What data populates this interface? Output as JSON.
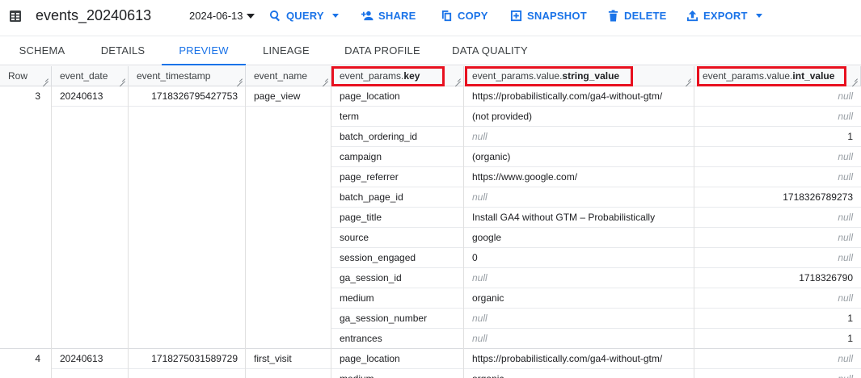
{
  "toolbar": {
    "title": "events_20240613",
    "date": "2024-06-13",
    "query_label": "QUERY",
    "share_label": "SHARE",
    "copy_label": "COPY",
    "snapshot_label": "SNAPSHOT",
    "delete_label": "DELETE",
    "export_label": "EXPORT",
    "accent": "#1a73e8"
  },
  "tabs": [
    {
      "label": "SCHEMA",
      "active": false
    },
    {
      "label": "DETAILS",
      "active": false
    },
    {
      "label": "PREVIEW",
      "active": true
    },
    {
      "label": "LINEAGE",
      "active": false
    },
    {
      "label": "DATA PROFILE",
      "active": false
    },
    {
      "label": "DATA QUALITY",
      "active": false
    }
  ],
  "columns": {
    "row": "Row",
    "event_date": "event_date",
    "event_timestamp": "event_timestamp",
    "event_name": "event_name",
    "key_prefix": "event_params.",
    "key_bold": "key",
    "str_prefix": "event_params.value.",
    "str_bold": "string_value",
    "int_prefix": "event_params.value.",
    "int_bold": "int_value"
  },
  "records": [
    {
      "row": "3",
      "event_date": "20240613",
      "event_timestamp": "1718326795427753",
      "event_name": "page_view",
      "params": [
        {
          "key": "page_location",
          "string_value": "https://probabilistically.com/ga4-without-gtm/",
          "int_value": "null"
        },
        {
          "key": "term",
          "string_value": "(not provided)",
          "int_value": "null"
        },
        {
          "key": "batch_ordering_id",
          "string_value": "null",
          "int_value": "1"
        },
        {
          "key": "campaign",
          "string_value": "(organic)",
          "int_value": "null"
        },
        {
          "key": "page_referrer",
          "string_value": "https://www.google.com/",
          "int_value": "null"
        },
        {
          "key": "batch_page_id",
          "string_value": "null",
          "int_value": "1718326789273"
        },
        {
          "key": "page_title",
          "string_value": "Install GA4 without GTM – Probabilistically",
          "int_value": "null"
        },
        {
          "key": "source",
          "string_value": "google",
          "int_value": "null"
        },
        {
          "key": "session_engaged",
          "string_value": "0",
          "int_value": "null"
        },
        {
          "key": "ga_session_id",
          "string_value": "null",
          "int_value": "1718326790"
        },
        {
          "key": "medium",
          "string_value": "organic",
          "int_value": "null"
        },
        {
          "key": "ga_session_number",
          "string_value": "null",
          "int_value": "1"
        },
        {
          "key": "entrances",
          "string_value": "null",
          "int_value": "1"
        }
      ]
    },
    {
      "row": "4",
      "event_date": "20240613",
      "event_timestamp": "1718275031589729",
      "event_name": "first_visit",
      "params": [
        {
          "key": "page_location",
          "string_value": "https://probabilistically.com/ga4-without-gtm/",
          "int_value": "null"
        },
        {
          "key": "medium",
          "string_value": "organic",
          "int_value": "null"
        }
      ]
    }
  ]
}
